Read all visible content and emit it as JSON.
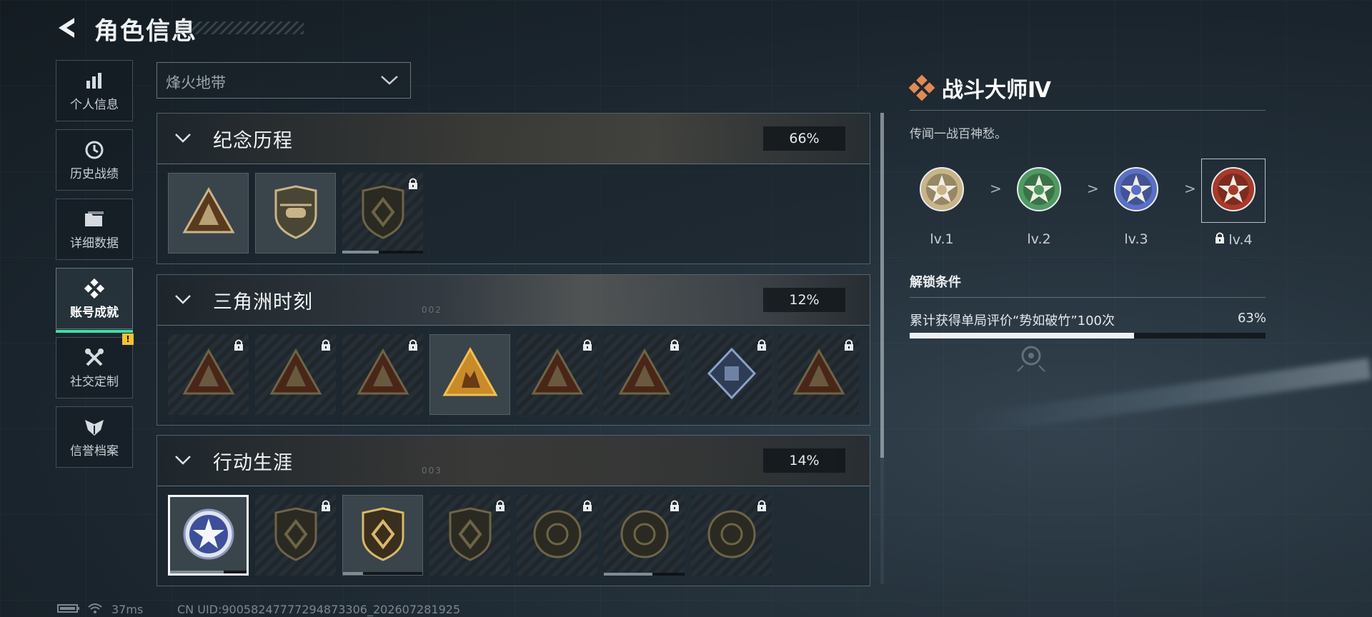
{
  "header": {
    "title": "角色信息"
  },
  "sidebar": {
    "items": [
      {
        "label": "个人信息",
        "icon": "bar-chart-icon"
      },
      {
        "label": "历史战绩",
        "icon": "clock-icon"
      },
      {
        "label": "详细数据",
        "icon": "folder-icon"
      },
      {
        "label": "账号成就",
        "icon": "achievement-icon",
        "active": true
      },
      {
        "label": "社交定制",
        "icon": "tools-icon",
        "alert": "!"
      },
      {
        "label": "信誉档案",
        "icon": "shield-wing-icon"
      }
    ]
  },
  "filter": {
    "selected": "烽火地带"
  },
  "sections": [
    {
      "title": "纪念历程",
      "percent": "66%",
      "tag": "",
      "badges": [
        {
          "icon": "triangle-shield-badge",
          "locked": false,
          "progress": null
        },
        {
          "icon": "helicopter-shield-badge",
          "locked": false,
          "progress": null
        },
        {
          "icon": "hex-shield-badge",
          "locked": true,
          "progress": 0.45
        }
      ]
    },
    {
      "title": "三角洲时刻",
      "percent": "12%",
      "tag": "002",
      "badges": [
        {
          "icon": "triangle-usb-badge",
          "locked": true
        },
        {
          "icon": "triangle-soldier-badge",
          "locked": true
        },
        {
          "icon": "triangle-gear-badge",
          "locked": true
        },
        {
          "icon": "triangle-squad-badge",
          "locked": false
        },
        {
          "icon": "triangle-team-badge",
          "locked": true
        },
        {
          "icon": "triangle-dragon-badge",
          "locked": true
        },
        {
          "icon": "diamond-fist-badge",
          "locked": true
        },
        {
          "icon": "triangle-skull-badge",
          "locked": true
        }
      ]
    },
    {
      "title": "行动生涯",
      "percent": "14%",
      "tag": "003",
      "badges": [
        {
          "icon": "star-medal-badge",
          "locked": false,
          "selected": true,
          "progress": 0.7
        },
        {
          "icon": "arrow-shield-badge",
          "locked": true
        },
        {
          "icon": "gold-shield-badge",
          "locked": false,
          "progress": 0.25
        },
        {
          "icon": "dice-shield-badge",
          "locked": true
        },
        {
          "icon": "ring-medal-badge",
          "locked": true
        },
        {
          "icon": "skull-medal-badge",
          "locked": true,
          "progress": 0.6
        },
        {
          "icon": "eye-medal-badge",
          "locked": true
        }
      ]
    }
  ],
  "detail": {
    "title": "战斗大师Ⅳ",
    "description": "传闻一战百神愁。",
    "levels": [
      {
        "label": "lv.1",
        "color": "#c9b487",
        "locked": false
      },
      {
        "label": "lv.2",
        "color": "#4f9a62",
        "locked": false
      },
      {
        "label": "lv.3",
        "color": "#5a6fc6",
        "locked": false
      },
      {
        "label": "lv.4",
        "color": "#a83a2a",
        "locked": true,
        "selected": true
      }
    ],
    "arrow": ">",
    "condition_title": "解锁条件",
    "condition_text": "累计获得单局评价“势如破竹”100次",
    "condition_percent": "63%",
    "condition_progress": 0.63
  },
  "footer": {
    "ping": "37ms",
    "uid": "CN UID:9005824777729487330​6_202607281925"
  },
  "colors": {
    "accent": "#3ee0a6",
    "gold": "#c9b487",
    "alert": "#f2c230"
  }
}
